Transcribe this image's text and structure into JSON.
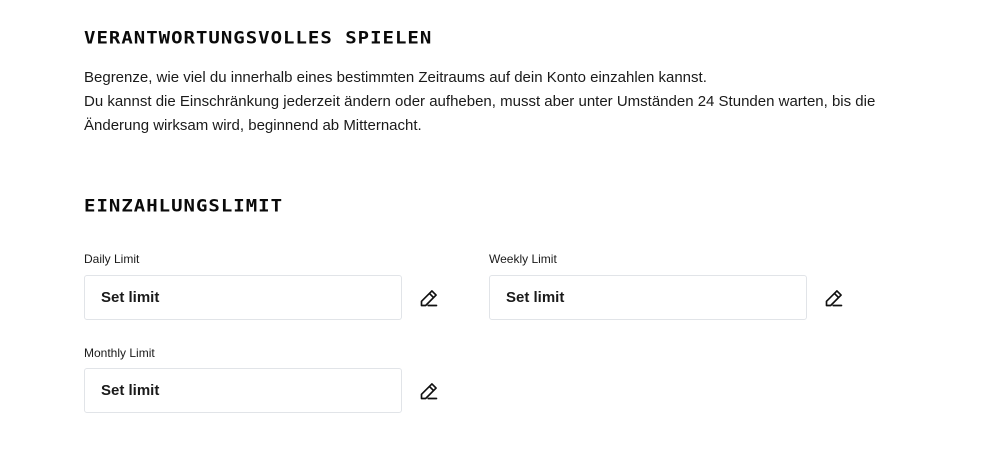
{
  "responsible_gaming": {
    "title": "VERANTWORTUNGSVOLLES SPIELEN",
    "description_line1": "Begrenze, wie viel du innerhalb eines bestimmten Zeitraums auf dein Konto einzahlen kannst.",
    "description_line2": "Du kannst die Einschränkung jederzeit ändern oder aufheben, musst aber unter Umständen 24 Stunden warten, bis die Änderung wirksam wird, beginnend ab Mitternacht."
  },
  "deposit_limit": {
    "title": "EINZAHLUNGSLIMIT",
    "daily": {
      "label": "Daily Limit",
      "placeholder": "Set limit",
      "value": ""
    },
    "weekly": {
      "label": "Weekly Limit",
      "placeholder": "Set limit",
      "value": ""
    },
    "monthly": {
      "label": "Monthly Limit",
      "placeholder": "Set limit",
      "value": ""
    },
    "edit_icon": "pencil-icon"
  }
}
